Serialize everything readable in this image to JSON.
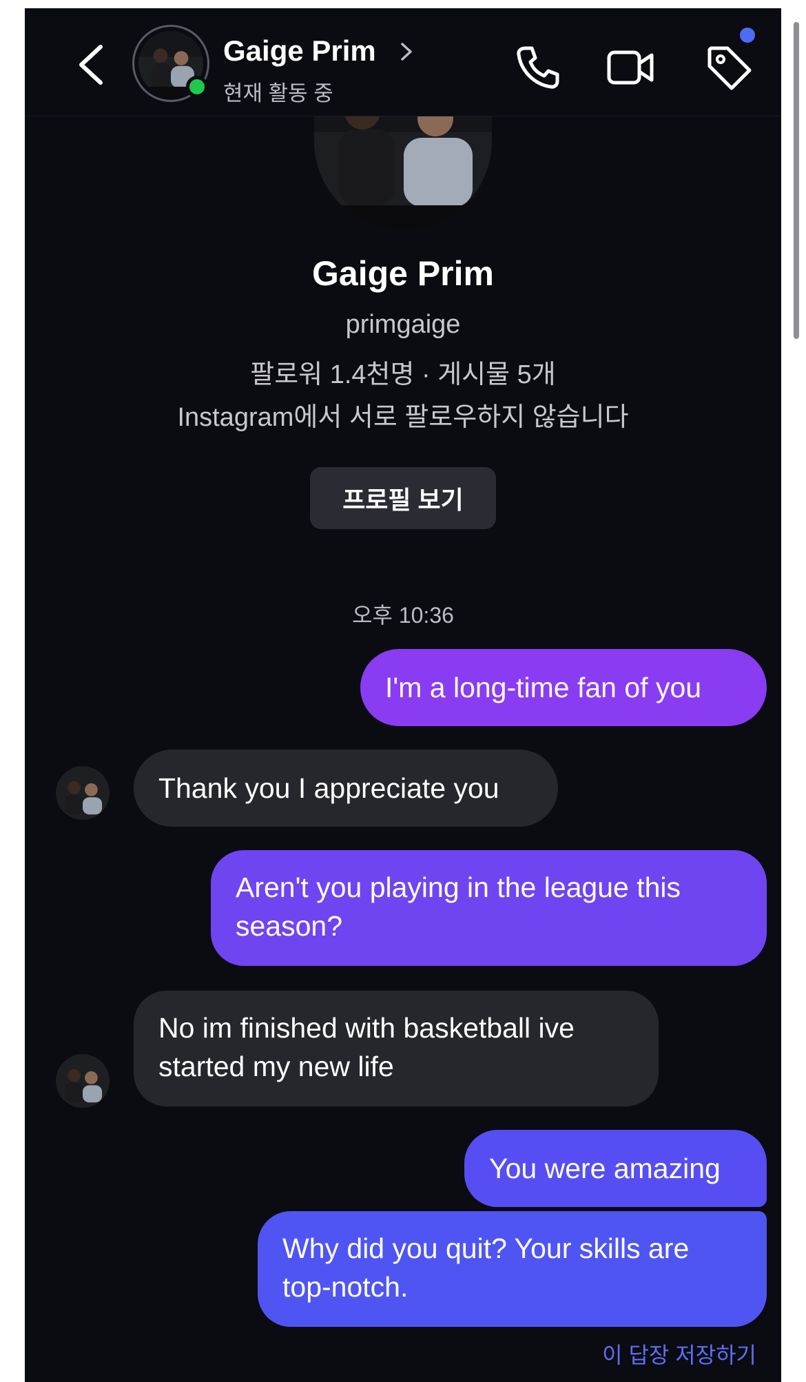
{
  "header": {
    "contact_name": "Gaige Prim",
    "status": "현재 활동 중",
    "icons": [
      "back-icon",
      "chevron-right-icon",
      "phone-icon",
      "video-icon",
      "tag-icon"
    ]
  },
  "profile": {
    "name": "Gaige Prim",
    "username": "primgaige",
    "stats": "팔로워 1.4천명 · 게시물 5개",
    "mutual_note": "Instagram에서 서로 팔로우하지 않습니다",
    "view_profile_label": "프로필 보기"
  },
  "thread": {
    "timestamp": "오후 10:36",
    "messages": [
      {
        "from": "me",
        "text": "I'm a long-time fan of you"
      },
      {
        "from": "them",
        "text": "Thank you I appreciate you"
      },
      {
        "from": "me",
        "text": "Aren't you playing in the league this season?"
      },
      {
        "from": "them",
        "text": "No im finished with basketball ive started my new life"
      },
      {
        "from": "me",
        "text": "You were amazing"
      },
      {
        "from": "me",
        "text": "Why did you quit? Your skills are top-notch."
      }
    ],
    "save_reply_label": "이 답장 저장하기"
  },
  "colors": {
    "background": "#0b0b12",
    "outgoing_bubble": "#7b3ff0",
    "incoming_bubble": "#26262d",
    "online": "#1ec94c",
    "accent_link": "#5b6ef6"
  }
}
